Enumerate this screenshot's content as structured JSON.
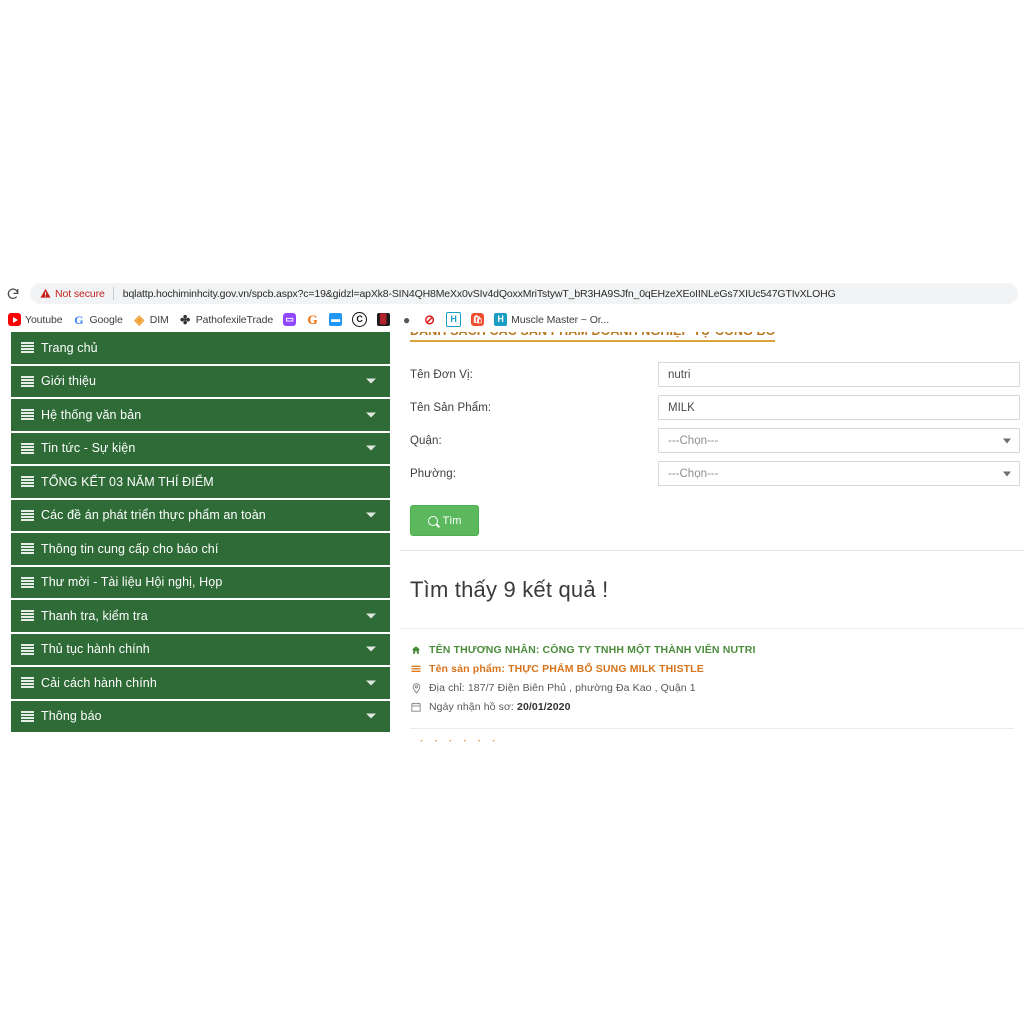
{
  "browser": {
    "reload_icon": "reload-icon",
    "security_warning_icon": "warning-triangle-icon",
    "security_label": "Not secure",
    "url": "bqlattp.hochiminhcity.gov.vn/spcb.aspx?c=19&gidzl=apXk8-SIN4QH8MeXx0vSIv4dQoxxMriTstywT_bR3HA9SJfn_0qEHzeXEoIINLeGs7XIUc547GTIvXLOHG",
    "bookmarks": [
      {
        "label": "Youtube",
        "icon": "youtube-icon"
      },
      {
        "label": "Google",
        "icon": "google-icon"
      },
      {
        "label": "DIM",
        "icon": "dim-diamond-icon"
      },
      {
        "label": "PathofexileTrade",
        "icon": "poe-icon"
      },
      {
        "label": "",
        "icon": "twitch-icon"
      },
      {
        "label": "",
        "icon": "grammarly-g-icon"
      },
      {
        "label": "",
        "icon": "blue-square-icon"
      },
      {
        "label": "",
        "icon": "crescent-c-icon"
      },
      {
        "label": "",
        "icon": "dark-red-icon"
      },
      {
        "label": "",
        "icon": "grey-sphere-icon"
      },
      {
        "label": "",
        "icon": "red-block-icon"
      },
      {
        "label": "",
        "icon": "h-outline-icon"
      },
      {
        "label": "",
        "icon": "shopee-bag-icon"
      },
      {
        "label": "Muscle Master ~ Or...",
        "icon": "h-filled-icon"
      }
    ]
  },
  "sidebar": {
    "items": [
      {
        "label": "Trang chủ",
        "has_caret": false
      },
      {
        "label": "Giới thiệu",
        "has_caret": true
      },
      {
        "label": "Hệ thống văn bản",
        "has_caret": true
      },
      {
        "label": "Tin tức - Sự kiện",
        "has_caret": true
      },
      {
        "label": "TỔNG KẾT 03 NĂM THÍ ĐIỂM",
        "has_caret": false
      },
      {
        "label": "Các đề án phát triển thực phẩm an toàn",
        "has_caret": true
      },
      {
        "label": "Thông tin cung cấp cho báo chí",
        "has_caret": false
      },
      {
        "label": "Thư mời - Tài liệu Hội nghị, Họp",
        "has_caret": false
      },
      {
        "label": "Thanh tra, kiểm tra",
        "has_caret": true
      },
      {
        "label": "Thủ tục hành chính",
        "has_caret": true
      },
      {
        "label": "Cải cách hành chính",
        "has_caret": true
      },
      {
        "label": "Thông báo",
        "has_caret": true
      }
    ]
  },
  "content": {
    "panel_title": "DANH SÁCH CÁC SẢN PHẨM DOANH NGHIỆP TỰ CÔNG BỐ",
    "form": {
      "fields": [
        {
          "label": "Tên Đơn Vị:",
          "type": "text",
          "value": "nutri"
        },
        {
          "label": "Tên Sản Phẩm:",
          "type": "text",
          "value": "MILK"
        },
        {
          "label": "Quận:",
          "type": "select",
          "value": "---Chọn---"
        },
        {
          "label": "Phường:",
          "type": "select",
          "value": "---Chọn---"
        }
      ],
      "search_button": {
        "label": "Tìm",
        "icon": "search-icon",
        "color": "#5cb85c"
      }
    },
    "results_count_text": "Tìm thấy 9 kết quả !",
    "results": [
      {
        "merchant_icon": "home-icon",
        "merchant_label": "TÊN THƯƠNG NHÂN: CÔNG TY TNHH MỘT THÀNH VIÊN NUTRI",
        "product_icon": "list-icon",
        "product_label": "Tên sản phẩm: THỰC PHẨM BỔ SUNG MILK THISTLE",
        "address_icon": "map-pin-icon",
        "address_label": "Địa chỉ: 187/7 Điện Biên Phủ , phường Đa Kao , Quận 1",
        "date_icon": "calendar-icon",
        "date_prefix": "Ngày nhận hồ sơ:",
        "date_value": "20/01/2020"
      }
    ],
    "next_result_peek": "· · · · · ·"
  },
  "colors": {
    "sidebar_green": "#2e6b37",
    "button_green": "#5cb85c",
    "title_orange": "#b9761e",
    "merchant_green": "#4b8c3b",
    "product_orange": "#d9731a",
    "not_secure_red": "#c5221f"
  }
}
